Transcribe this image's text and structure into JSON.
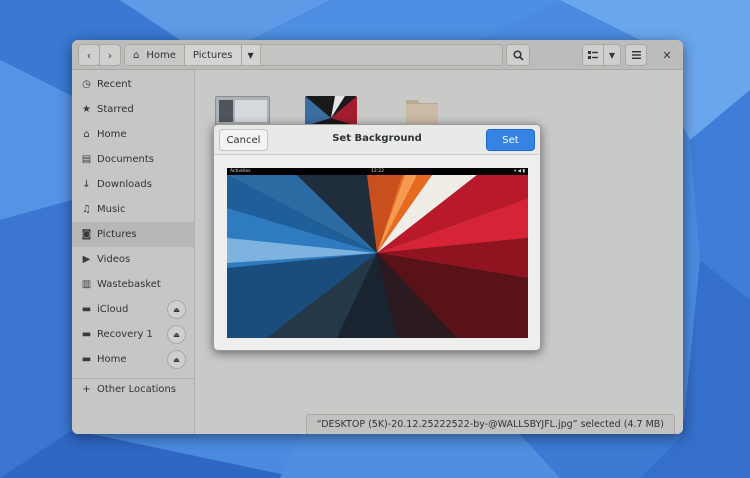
{
  "colors": {
    "desktop": "#3f7fd8",
    "window_bg": "#c9c9c7",
    "accent": "#3584e4"
  },
  "headerbar": {
    "back_icon": "chevron-left-icon",
    "forward_icon": "chevron-right-icon",
    "path": [
      {
        "label": "Home",
        "icon": "home-icon"
      },
      {
        "label": "Pictures"
      }
    ],
    "search_icon": "search-icon",
    "view_icon": "list-view-icon",
    "menu_icon": "hamburger-menu-icon",
    "close_glyph": "✕"
  },
  "sidebar": {
    "items": [
      {
        "label": "Recent",
        "icon": "clock-icon"
      },
      {
        "label": "Starred",
        "icon": "star-icon"
      },
      {
        "label": "Home",
        "icon": "home-icon"
      },
      {
        "label": "Documents",
        "icon": "document-icon"
      },
      {
        "label": "Downloads",
        "icon": "download-icon"
      },
      {
        "label": "Music",
        "icon": "music-icon"
      },
      {
        "label": "Pictures",
        "icon": "camera-icon",
        "active": true
      },
      {
        "label": "Videos",
        "icon": "video-icon"
      },
      {
        "label": "Wastebasket",
        "icon": "trash-icon"
      },
      {
        "label": "iCloud",
        "icon": "drive-icon",
        "eject": true
      },
      {
        "label": "Recovery 1",
        "icon": "drive-icon",
        "eject": true
      },
      {
        "label": "Home",
        "icon": "drive-icon",
        "eject": true
      }
    ],
    "other_locations": "Other Locations"
  },
  "status": {
    "text": "“DESKTOP (5K)-20.12.25222522-by-@WALLSBYJFL.jpg” selected  (4.7 MB)"
  },
  "dialog": {
    "title": "Set Background",
    "cancel_label": "Cancel",
    "set_label": "Set",
    "preview_activities": "Activities",
    "preview_clock": "12:22"
  }
}
